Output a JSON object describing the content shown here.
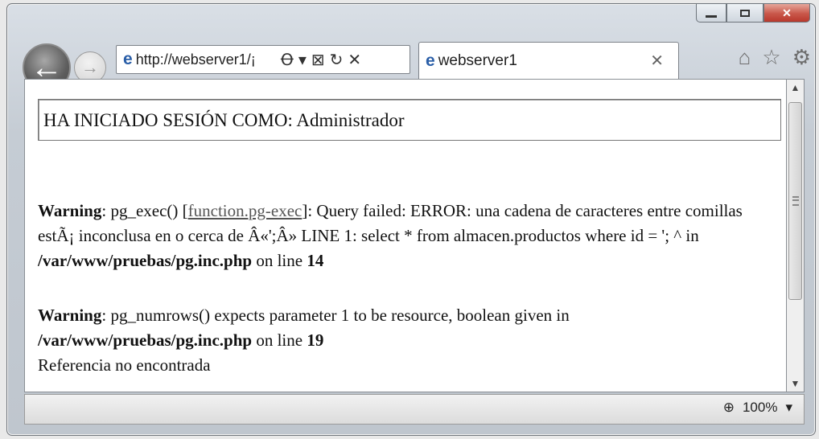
{
  "window": {
    "controls": {
      "minimize": "",
      "maximize": "",
      "close": "✕"
    }
  },
  "nav": {
    "back_icon": "back-arrow-icon",
    "forward_icon": "forward-arrow-icon"
  },
  "address_bar": {
    "url": "http://webserver1/¡",
    "search_icon": "Ꝋ",
    "dropdown_icon": "▾",
    "compat_icon": "⊠",
    "refresh_icon": "↻",
    "stop_icon": "✕"
  },
  "tab": {
    "label": "webserver1",
    "close": "✕"
  },
  "toolbar_icons": {
    "home": "⌂",
    "favorites": "☆",
    "settings": "⚙"
  },
  "page": {
    "session_text": "HA INICIADO SESIÓN COMO: Administrador",
    "warning1": {
      "label": "Warning",
      "func": ": pg_exec() [",
      "link": "function.pg-exec",
      "text": "]: Query failed: ERROR: una cadena de caracteres entre comillas estÃ¡ inconclusa en o cerca de Â«';Â» LINE 1: select * from almacen.productos where id = '; ^ in ",
      "path": "/var/www/pruebas/pg.inc.php",
      "online": " on line ",
      "line": "14"
    },
    "warning2": {
      "label": "Warning",
      "text": ": pg_numrows() expects parameter 1 to be resource, boolean given in ",
      "path": "/var/www/pruebas/pg.inc.php",
      "online": " on line ",
      "line": "19"
    },
    "not_found": "Referencia no encontrada"
  },
  "status_bar": {
    "zoom": "100%",
    "zoom_icon": "⊕",
    "dropdown": "▾"
  },
  "colors": {
    "chrome": "#c5ccd4",
    "close_button": "#c9574a",
    "link": "#555555"
  }
}
